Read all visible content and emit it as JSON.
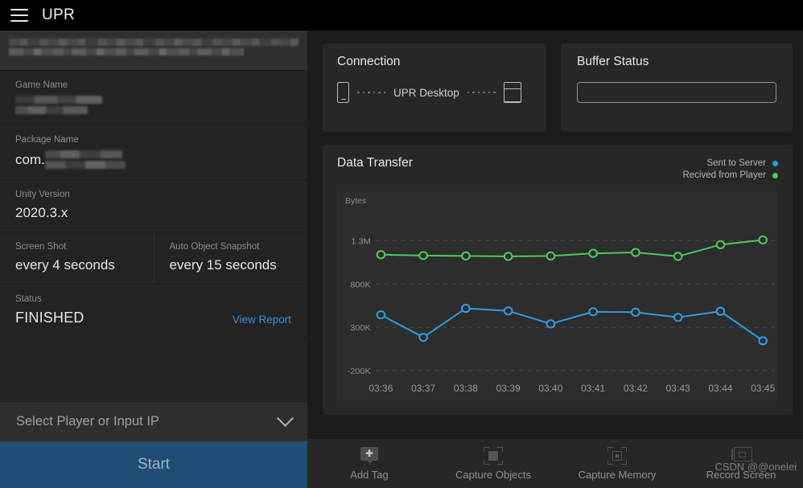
{
  "topbar": {
    "menu_icon": "hamburger-icon",
    "title": "UPR"
  },
  "sidebar": {
    "fields": [
      {
        "label": "Game Name",
        "value": "",
        "redacted": true
      },
      {
        "label": "Package Name",
        "value": "com.",
        "redacted": true
      },
      {
        "label": "Unity Version",
        "value": "2020.3.x",
        "redacted": false
      }
    ],
    "screen_shot": {
      "label": "Screen Shot",
      "value": "every 4 seconds"
    },
    "auto_object_snapshot": {
      "label": "Auto Object Snapshot",
      "value": "every 15 seconds"
    },
    "status": {
      "label": "Status",
      "value": "FINISHED",
      "link": "View Report"
    },
    "select_player": {
      "placeholder": "Select Player or Input IP",
      "icon": "chevron-down-icon"
    },
    "start_button": {
      "label": "Start"
    }
  },
  "connection": {
    "title": "Connection",
    "device_icon": "phone-icon",
    "server_icon": "server-rack-icon",
    "label": "UPR Desktop"
  },
  "buffer": {
    "title": "Buffer Status",
    "value": ""
  },
  "data_transfer": {
    "title": "Data Transfer",
    "legend": [
      {
        "label": "Sent to Server",
        "color": "#2f9ae0"
      },
      {
        "label": "Recived from Player",
        "color": "#4cc85b"
      }
    ]
  },
  "chart_data": {
    "type": "line",
    "title": "Data Transfer",
    "xlabel": "",
    "ylabel": "Bytes",
    "x": [
      "03:36",
      "03:37",
      "03:38",
      "03:39",
      "03:40",
      "03:41",
      "03:42",
      "03:43",
      "03:44",
      "03:45"
    ],
    "yticks": [
      1300000,
      800000,
      300000,
      -200000
    ],
    "ytick_labels": [
      "1.3M",
      "800K",
      "300K",
      "-200K"
    ],
    "ylim": [
      -200000,
      1500000
    ],
    "grid": true,
    "legend_position": "top-right",
    "series": [
      {
        "name": "Recived from Player",
        "color": "#4cc85b",
        "values": [
          1140000,
          1130000,
          1125000,
          1120000,
          1125000,
          1155000,
          1165000,
          1120000,
          1255000,
          1310000
        ]
      },
      {
        "name": "Sent to Server",
        "color": "#2f9ae0",
        "values": [
          445000,
          185000,
          520000,
          490000,
          340000,
          480000,
          475000,
          415000,
          485000,
          145000
        ]
      }
    ]
  },
  "toolbar": {
    "items": [
      {
        "label": "Add Tag",
        "icon": "add-tag-icon"
      },
      {
        "label": "Capture Objects",
        "icon": "capture-objects-icon"
      },
      {
        "label": "Capture Memory",
        "icon": "capture-memory-icon"
      },
      {
        "label": "Record Screen",
        "icon": "record-screen-icon"
      }
    ]
  },
  "watermark": {
    "text": "CSDN @@onelei"
  }
}
